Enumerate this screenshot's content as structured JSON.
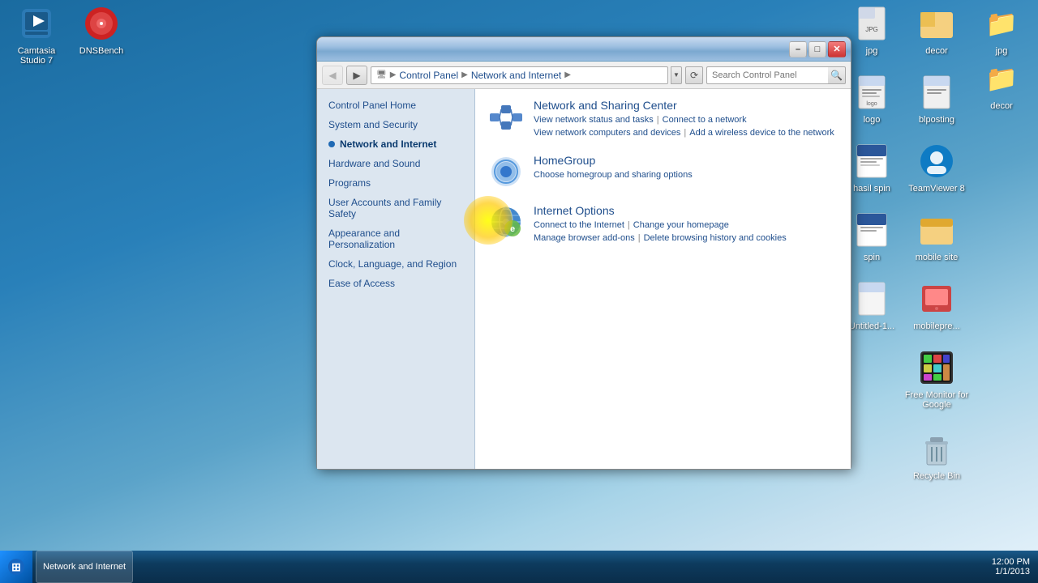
{
  "desktop": {
    "icons_left": [
      {
        "id": "camtasia",
        "label": "Camtasia\nStudio 7",
        "emoji": "🎬"
      },
      {
        "id": "dnsbench",
        "label": "DNSBench",
        "emoji": "🔴"
      }
    ],
    "icons_right": [
      {
        "id": "jpg",
        "label": "jpg",
        "emoji": "📁"
      },
      {
        "id": "decor",
        "label": "decor",
        "emoji": "📁"
      },
      {
        "id": "logo",
        "label": "logo",
        "emoji": "📄"
      },
      {
        "id": "blposting",
        "label": "blposting",
        "emoji": "📄"
      },
      {
        "id": "hasil-spin",
        "label": "hasil spin",
        "emoji": "📝"
      },
      {
        "id": "teamviewer",
        "label": "TeamViewer\n8",
        "emoji": "🖥️"
      },
      {
        "id": "spin",
        "label": "spin",
        "emoji": "📝"
      },
      {
        "id": "mobile-site",
        "label": "mobile site",
        "emoji": "📁"
      },
      {
        "id": "untitled",
        "label": "Untitled-1...",
        "emoji": "📄"
      },
      {
        "id": "mobilepre",
        "label": "mobilepre...",
        "emoji": "📦"
      },
      {
        "id": "free-monitor",
        "label": "Free Monitor\nfor Google",
        "emoji": "🟩"
      },
      {
        "id": "recycle-bin",
        "label": "Recycle Bin",
        "emoji": "🗑️"
      }
    ]
  },
  "window": {
    "title": "Network and Internet",
    "titlebar_buttons": {
      "minimize": "–",
      "maximize": "□",
      "close": "✕"
    },
    "addressbar": {
      "back_disabled": true,
      "forward_disabled": false,
      "breadcrumb": [
        "Control Panel",
        "Network and Internet"
      ],
      "search_placeholder": "Search Control Panel"
    },
    "sidebar": {
      "items": [
        {
          "id": "control-panel-home",
          "label": "Control Panel Home",
          "active": false,
          "dot": false
        },
        {
          "id": "system-security",
          "label": "System and Security",
          "active": false,
          "dot": false
        },
        {
          "id": "network-internet",
          "label": "Network and Internet",
          "active": true,
          "dot": true
        },
        {
          "id": "hardware-sound",
          "label": "Hardware and Sound",
          "active": false,
          "dot": false
        },
        {
          "id": "programs",
          "label": "Programs",
          "active": false,
          "dot": false
        },
        {
          "id": "user-accounts",
          "label": "User Accounts and Family Safety",
          "active": false,
          "dot": false
        },
        {
          "id": "appearance",
          "label": "Appearance and Personalization",
          "active": false,
          "dot": false
        },
        {
          "id": "clock-language",
          "label": "Clock, Language, and Region",
          "active": false,
          "dot": false
        },
        {
          "id": "ease-access",
          "label": "Ease of Access",
          "active": false,
          "dot": false
        }
      ]
    },
    "content": {
      "sections": [
        {
          "id": "network-sharing",
          "title": "Network and Sharing Center",
          "links_row1": [
            {
              "label": "View network status and tasks",
              "sep": true
            },
            {
              "label": "Connect to a network",
              "sep": false
            }
          ],
          "links_row2": [
            {
              "label": "View network computers and devices",
              "sep": true
            },
            {
              "label": "Add a wireless device to the network",
              "sep": false
            }
          ]
        },
        {
          "id": "homegroup",
          "title": "HomeGroup",
          "links_row1": [
            {
              "label": "Choose homegroup and sharing options",
              "sep": false
            }
          ],
          "links_row2": []
        },
        {
          "id": "internet-options",
          "title": "Internet Options",
          "links_row1": [
            {
              "label": "Connect to the Internet",
              "sep": true
            },
            {
              "label": "Change your homepage",
              "sep": false
            }
          ],
          "links_row2": [
            {
              "label": "Manage browser add-ons",
              "sep": true
            },
            {
              "label": "Delete browsing history and cookies",
              "sep": false
            }
          ]
        }
      ]
    }
  }
}
